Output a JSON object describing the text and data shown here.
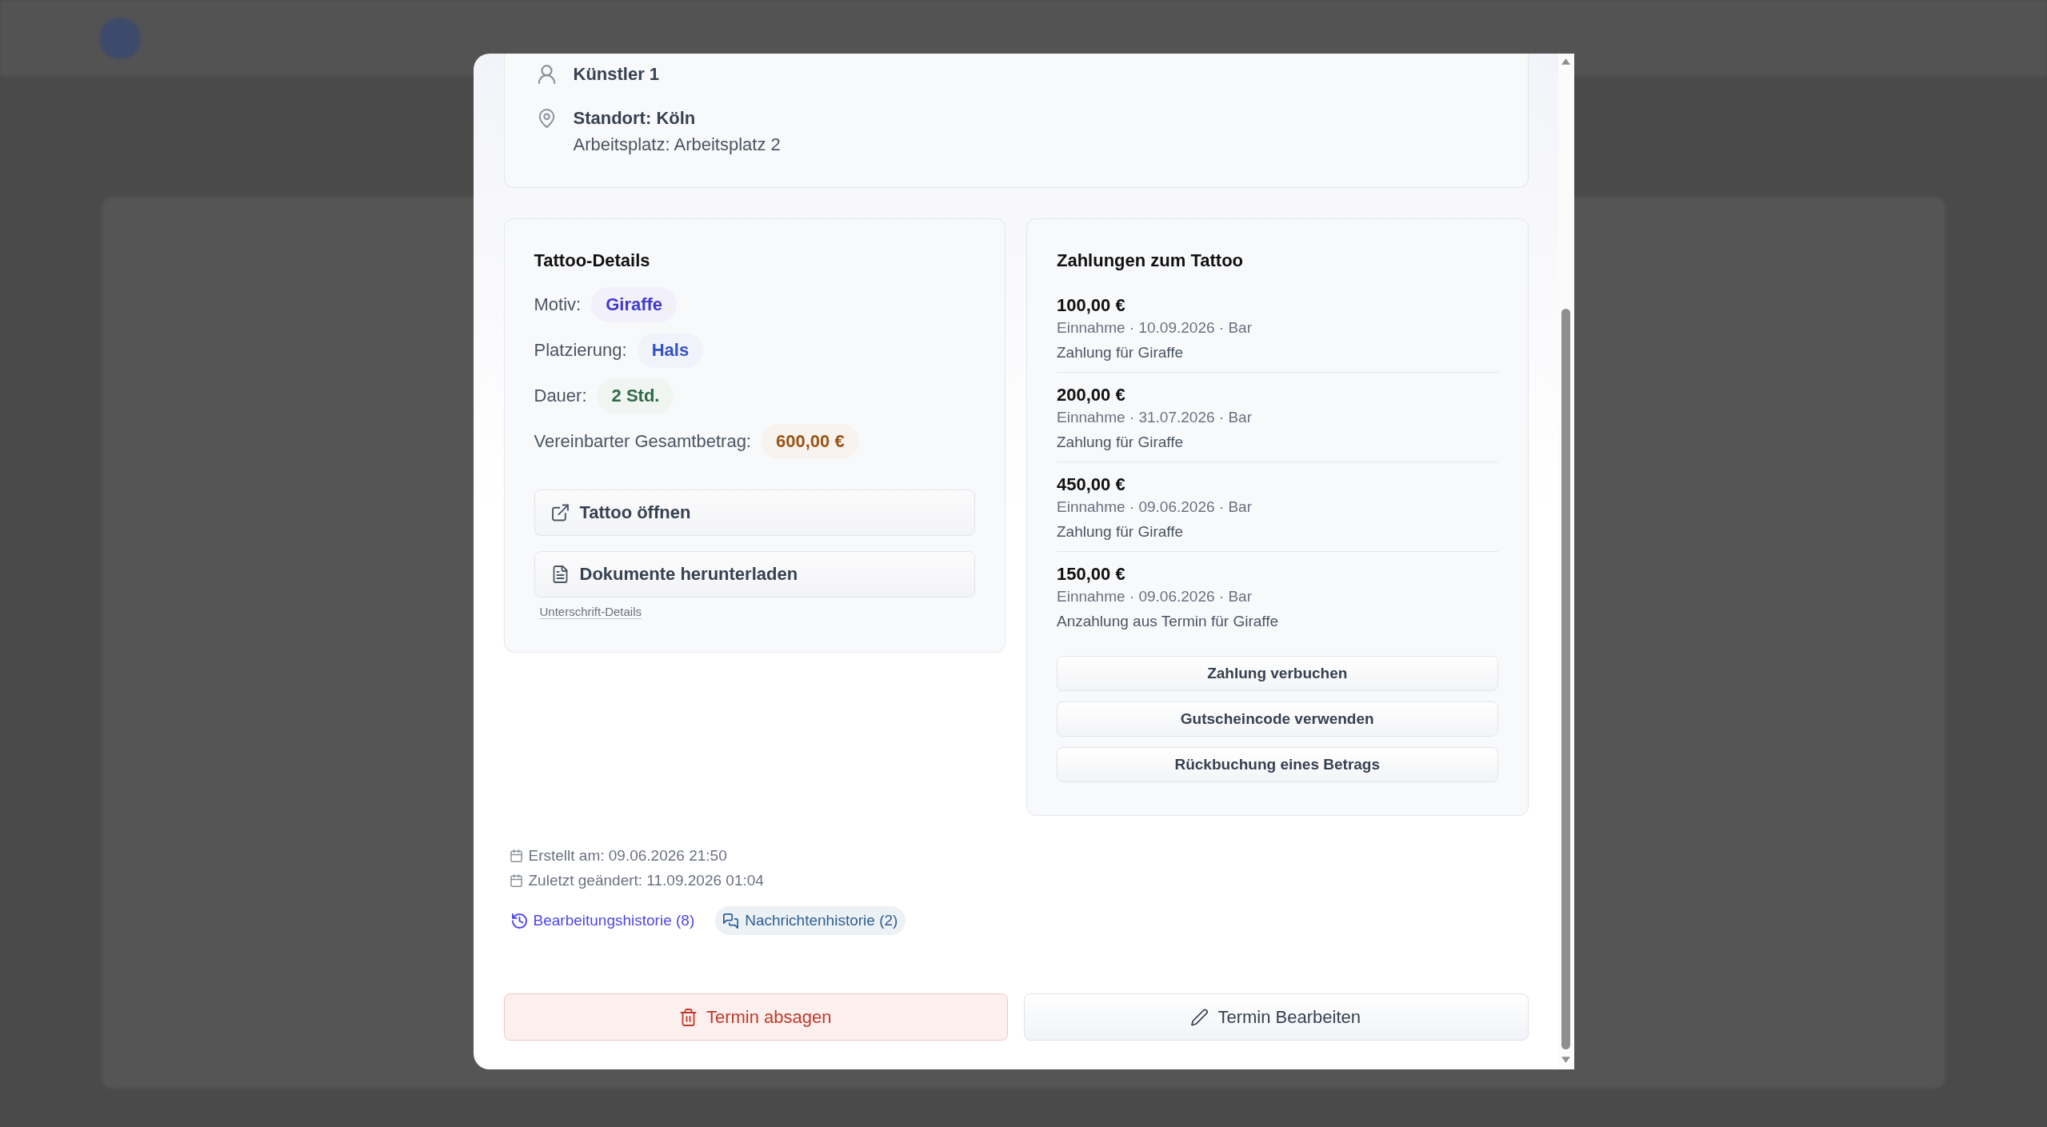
{
  "modal": {
    "info_card": {
      "artist": "Künstler 1",
      "location": "Standort: Köln",
      "workplace": "Arbeitsplatz: Arbeitsplatz 2"
    },
    "tattoo_details": {
      "title": "Tattoo-Details",
      "fields": [
        {
          "label": "Motiv:",
          "value": "Giraffe",
          "color": "#4338ca"
        },
        {
          "label": "Platzierung:",
          "value": "Hals",
          "color": "#3451c7"
        },
        {
          "label": "Dauer:",
          "value": "2 Std.",
          "color": "#2f6b47"
        },
        {
          "label": "Vereinbarter Gesamtbetrag:",
          "value": "600,00 €",
          "color": "#9a5518"
        }
      ],
      "actions": [
        {
          "kind": "open",
          "label": "Tattoo öffnen"
        },
        {
          "kind": "document",
          "label": "Dokumente herunterladen"
        }
      ],
      "signature_link": "Unterschrift-Details"
    },
    "payments": {
      "title": "Zahlungen zum Tattoo",
      "items": [
        {
          "amount": "100,00 €",
          "meta": "Einnahme · 10.09.2026 · Bar",
          "description": "Zahlung für Giraffe"
        },
        {
          "amount": "200,00 €",
          "meta": "Einnahme · 31.07.2026 · Bar",
          "description": "Zahlung für Giraffe"
        },
        {
          "amount": "450,00 €",
          "meta": "Einnahme · 09.06.2026 · Bar",
          "description": "Zahlung für Giraffe"
        },
        {
          "amount": "150,00 €",
          "meta": "Einnahme · 09.06.2026 · Bar",
          "description": "Anzahlung aus Termin für Giraffe"
        }
      ],
      "buttons": [
        "Zahlung verbuchen",
        "Gutscheincode verwenden",
        "Rückbuchung eines Betrags"
      ]
    },
    "timestamps": [
      "Erstellt am: 09.06.2026 21:50",
      "Zuletzt geändert: 11.09.2026 01:04"
    ],
    "history_links": [
      {
        "kind": "edits",
        "label": "Bearbeitungshistorie (8)",
        "color": "#4f46e5",
        "highlighted": false
      },
      {
        "kind": "messages",
        "label": "Nachrichtenhistorie (2)",
        "color": "#2e5f92",
        "highlighted": true
      }
    ],
    "footer_buttons": [
      {
        "kind": "danger",
        "label": "Termin absagen"
      },
      {
        "kind": "default",
        "label": "Termin Bearbeiten"
      }
    ]
  }
}
